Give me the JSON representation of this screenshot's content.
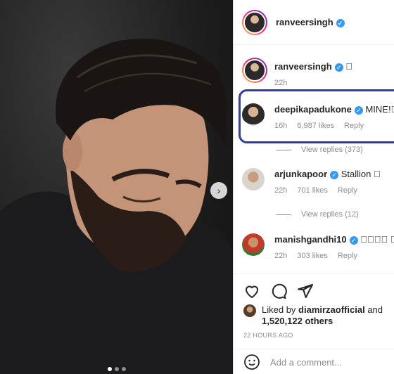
{
  "post": {
    "carousel_next_icon": "chevron-right-icon",
    "carousel_dots": 3,
    "carousel_active_index": 0
  },
  "header": {
    "username": "ranveersingh",
    "verified": true
  },
  "caption": {
    "username": "ranveersingh",
    "text": "\u0000",
    "time": "22h"
  },
  "comments": [
    {
      "username": "deepikapadukone",
      "text": "MINE!\u0000\u0000",
      "time": "16h",
      "likes": "6,987 likes",
      "reply": "Reply",
      "view_replies": "View replies (373)"
    },
    {
      "username": "arjunkapoor",
      "text": "Stallion \u0000",
      "time": "22h",
      "likes": "701 likes",
      "reply": "Reply",
      "view_replies": "View replies (12)"
    },
    {
      "username": "manishgandhi10",
      "text": "\u0000\u0000\u0000\u0000 \u0000\u0000\u0000",
      "time": "22h",
      "likes": "303 likes",
      "reply": "Reply"
    }
  ],
  "likes": {
    "prefix": "Liked by",
    "user": "diamirzaofficial",
    "mid": "and",
    "count": "1,520,122 others"
  },
  "timestamp": "22 HOURS AGO",
  "add_comment": {
    "placeholder": "Add a comment...",
    "icon": "smiley-icon"
  },
  "colors": {
    "verified": "#3897f0",
    "highlight": "#2b3ea8",
    "muted": "#8e8e8e"
  }
}
